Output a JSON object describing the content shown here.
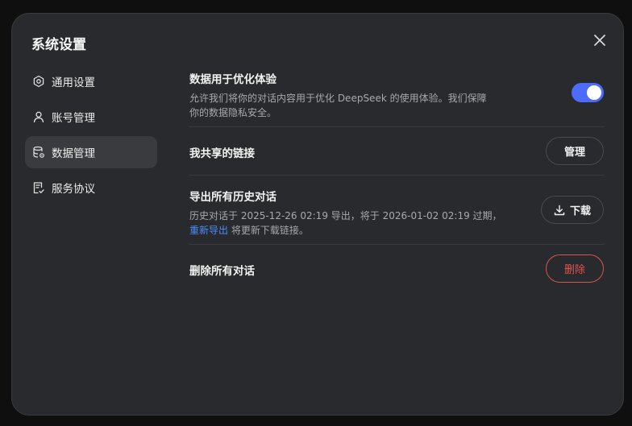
{
  "dialog": {
    "title": "系统设置"
  },
  "sidebar": {
    "items": [
      {
        "label": "通用设置",
        "icon": "gear-icon"
      },
      {
        "label": "账号管理",
        "icon": "user-icon"
      },
      {
        "label": "数据管理",
        "icon": "database-settings-icon",
        "active": true
      },
      {
        "label": "服务协议",
        "icon": "document-icon"
      }
    ]
  },
  "settings": {
    "optimize": {
      "title": "数据用于优化体验",
      "desc_line1": "允许我们将你的对话内容用于优化 DeepSeek 的使用体验。我们保障",
      "desc_line2": "你的数据隐私安全。",
      "enabled": true
    },
    "shared_links": {
      "title": "我共享的链接",
      "button": "管理"
    },
    "export": {
      "title": "导出所有历史对话",
      "desc_line1": "历史对话于 2025-12-26 02:19 导出，将于 2026-01-02 02:19 过期，",
      "link": "重新导出",
      "desc_line2_rest": " 将更新下载链接。",
      "button": "下载"
    },
    "delete_all": {
      "title": "删除所有对话",
      "button": "删除"
    }
  },
  "colors": {
    "accent": "#4d6bfe",
    "link": "#4d8cff",
    "danger": "#e5544f"
  }
}
